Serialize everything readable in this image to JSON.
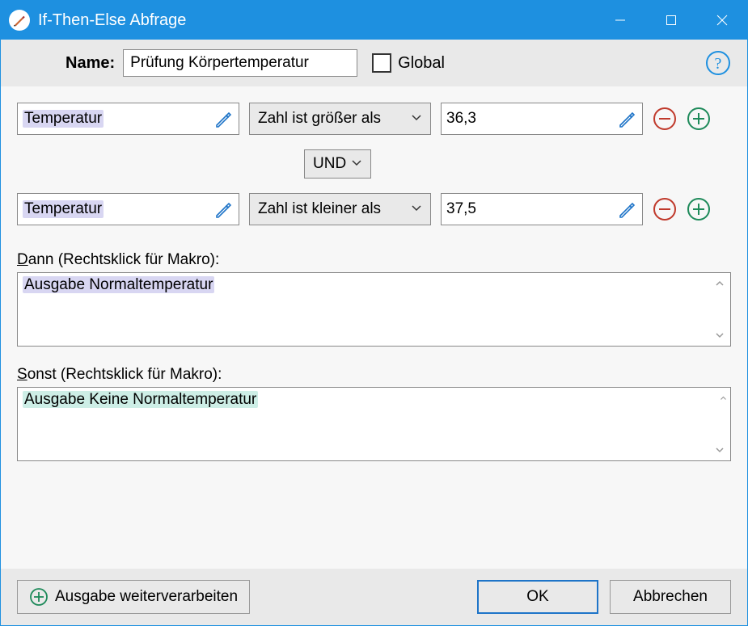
{
  "window": {
    "title": "If-Then-Else Abfrage"
  },
  "header": {
    "name_label": "Name:",
    "name_value": "Prüfung Körpertemperatur",
    "global_label": "Global"
  },
  "conditions": [
    {
      "variable": "Temperatur",
      "operator": "Zahl ist größer als",
      "value": "36,3"
    },
    {
      "variable": "Temperatur",
      "operator": "Zahl ist kleiner als",
      "value": "37,5"
    }
  ],
  "join_operator": "UND",
  "dann": {
    "prefix": "D",
    "underlined": "",
    "label_rest": "ann (Rechtsklick für Makro):",
    "macro": "Ausgabe Normaltemperatur"
  },
  "sonst": {
    "prefix": "S",
    "underlined": "",
    "label_rest": "onst (Rechtsklick für Makro):",
    "macro": "Ausgabe Keine Normaltemperatur"
  },
  "footer": {
    "process_label": "Ausgabe weiterverarbeiten",
    "ok_label": "OK",
    "cancel_label": "Abbrechen"
  }
}
